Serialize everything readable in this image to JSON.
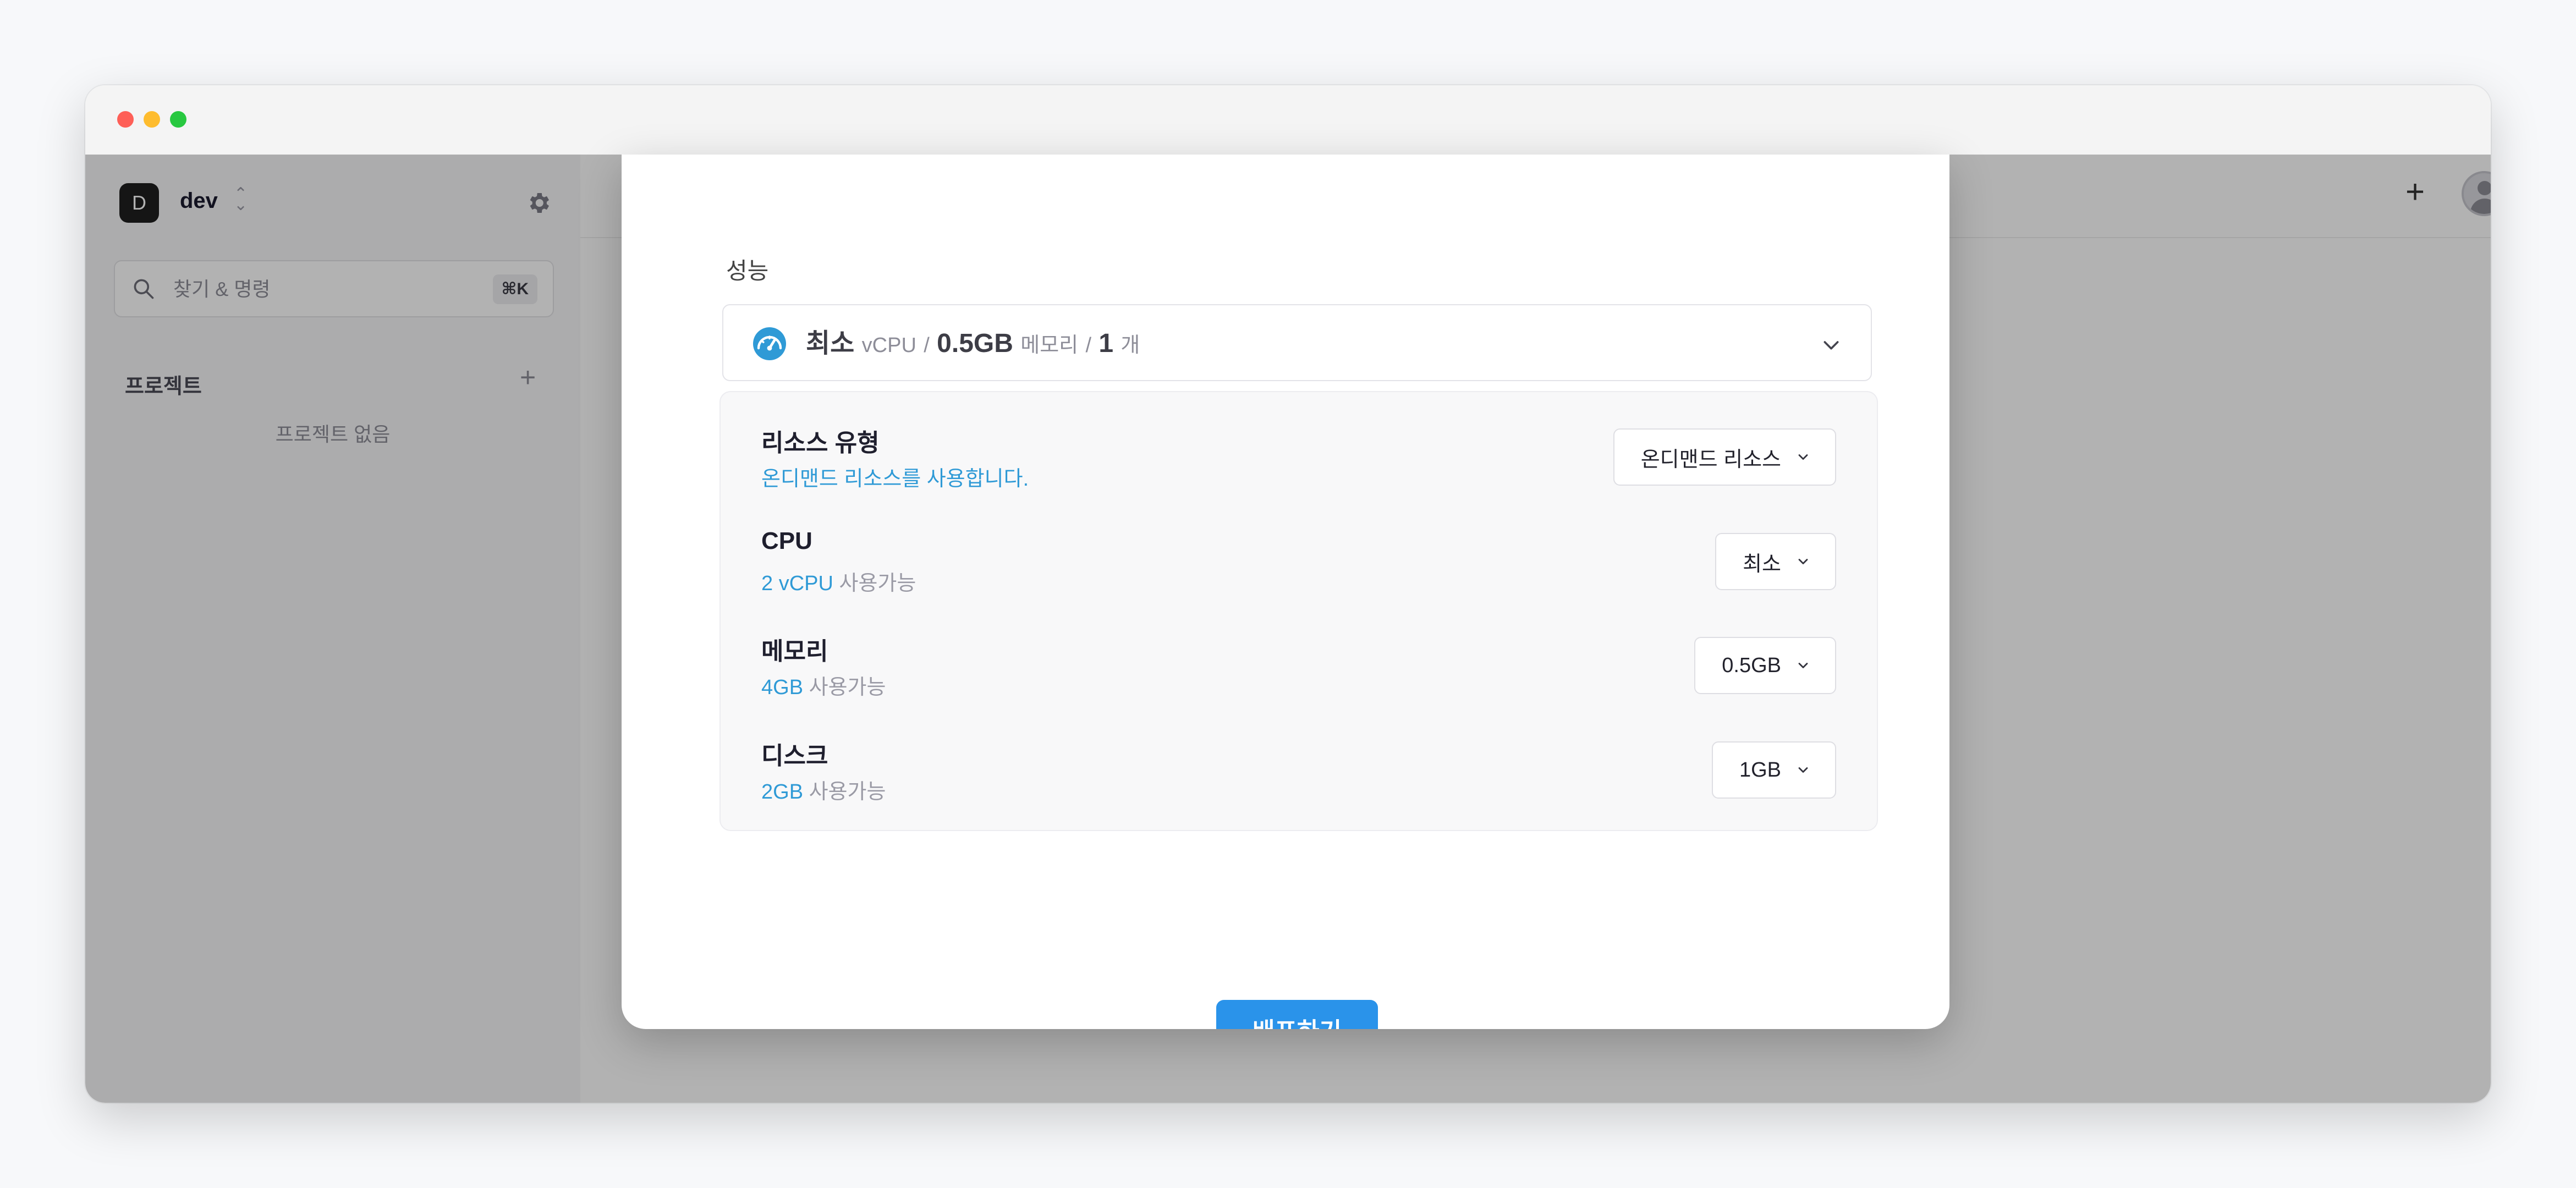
{
  "window": {
    "controls": [
      "close",
      "minimize",
      "zoom"
    ]
  },
  "sidebar": {
    "workspace": {
      "initial": "D",
      "name": "dev"
    },
    "search": {
      "placeholder": "찾기 & 명령",
      "shortcut": "⌘K"
    },
    "projects": {
      "label": "프로젝트",
      "empty_text": "프로젝트 없음"
    }
  },
  "topbar": {
    "add_icon": "plus-icon",
    "avatar_icon": "user-avatar-icon"
  },
  "modal": {
    "performance": {
      "label": "성능",
      "summary": {
        "cpu_value": "최소",
        "cpu_unit": "vCPU",
        "sep1": "/",
        "memory_value": "0.5GB",
        "memory_unit": "메모리",
        "sep2": "/",
        "count_value": "1",
        "count_unit": "개"
      }
    },
    "resources": [
      {
        "title": "리소스 유형",
        "sub_accent": "온디맨드 리소스를 사용합니다.",
        "sub_rest": "",
        "value": "온디맨드 리소스"
      },
      {
        "title": "CPU",
        "sub_accent": "2 vCPU",
        "sub_rest": " 사용가능",
        "value": "최소"
      },
      {
        "title": "메모리",
        "sub_accent": "4GB",
        "sub_rest": " 사용가능",
        "value": "0.5GB"
      },
      {
        "title": "디스크",
        "sub_accent": "2GB",
        "sub_rest": " 사용가능",
        "value": "1GB"
      }
    ],
    "deploy_label": "배포하기"
  },
  "colors": {
    "accent": "#2f9ad6",
    "primary_button": "#2a93ea",
    "overlay": "rgba(0,0,0,0.30)"
  }
}
